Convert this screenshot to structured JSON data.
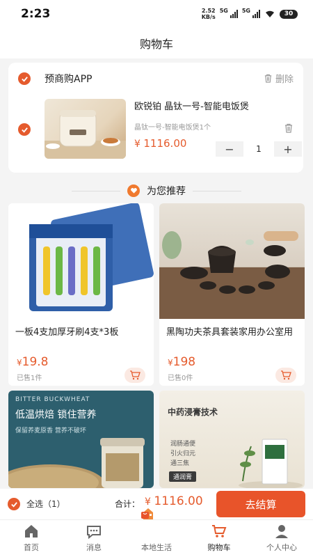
{
  "status_bar": {
    "time": "2:23",
    "net_speed_value": "2.52",
    "net_speed_unit": "KB/s",
    "signal1": "5G",
    "signal2": "5G",
    "battery": "30"
  },
  "header": {
    "title": "购物车"
  },
  "cart": {
    "store_name": "预商购APP",
    "delete_label": "删除",
    "item": {
      "title": "欧锐铂 晶钛一号-智能电饭煲",
      "spec": "晶钛一号-智能电饭煲1个",
      "price_symbol": "¥",
      "price": "1116.00",
      "quantity": "1",
      "minus": "−",
      "plus": "+"
    }
  },
  "recommend": {
    "title": "为您推荐",
    "products": [
      {
        "name": "一板4支加厚牙刷4支*3板",
        "price_symbol": "¥",
        "price": "19.8",
        "sold": "已售1件"
      },
      {
        "name": "黑陶功夫茶具套装家用办公室用",
        "price_symbol": "¥",
        "price": "198",
        "sold": "已售0件"
      },
      {
        "banner_en": "BITTER BUCKWHEAT",
        "banner_title": "低温烘焙 锁住营养",
        "banner_sub": "保留养麦原香 营养不破坏"
      },
      {
        "banner_title": "中药浸膏技术",
        "banner_lines": [
          "润肠通便",
          "引火归元",
          "通三焦"
        ],
        "banner_tag": "通润膏"
      }
    ]
  },
  "checkout": {
    "select_all": "全选（1）",
    "total_label": "合计：",
    "price_symbol": "¥",
    "total": "1116.00",
    "button": "去结算"
  },
  "tabbar": [
    {
      "label": "首页",
      "icon": "home-icon"
    },
    {
      "label": "消息",
      "icon": "message-icon"
    },
    {
      "label": "本地生活",
      "icon": "local-life-icon"
    },
    {
      "label": "购物车",
      "icon": "cart-icon"
    },
    {
      "label": "个人中心",
      "icon": "person-icon"
    }
  ],
  "colors": {
    "accent": "#e55b2d",
    "checkout": "#e8542a"
  }
}
